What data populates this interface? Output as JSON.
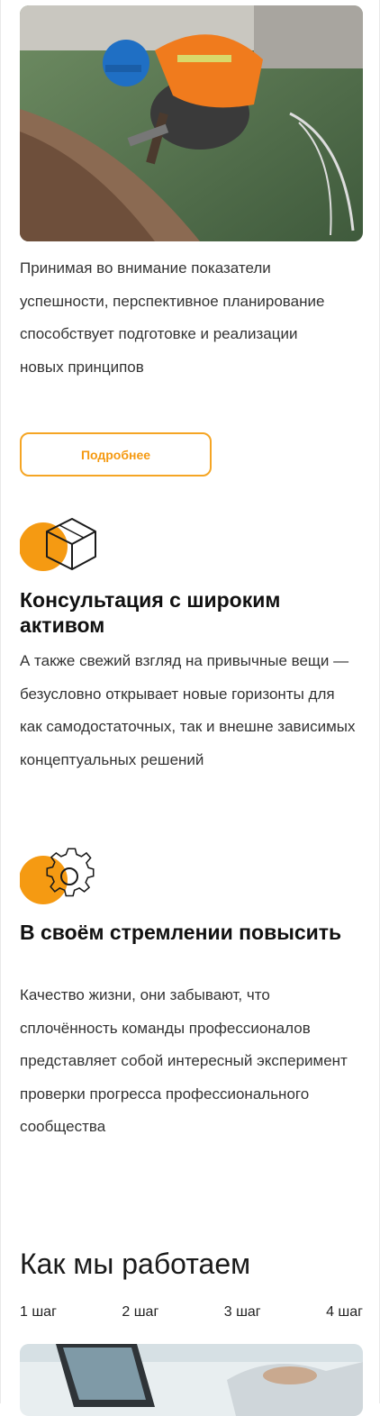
{
  "intro": {
    "text": "Принимая во внимание показатели успешности, перспективное планирование способствует подготовке и реализации новых принципов",
    "button_label": "Подробнее"
  },
  "features": [
    {
      "icon": "box-icon",
      "title": "Консультация с широким активом",
      "text": "А также свежий взгляд на привычные вещи — безусловно открывает новые горизонты для как самодостаточных, так и внешне зависимых концептуальных решений"
    },
    {
      "icon": "gear-icon",
      "title": "В своём стремлении повысить",
      "text": "Качество жизни, они забывают, что сплочённость команды профессионалов представляет собой интересный эксперимент проверки прогресса профессионального сообщества"
    }
  ],
  "process": {
    "title": "Как мы работаем",
    "steps": [
      "1 шаг",
      "2 шаг",
      "3 шаг",
      "4 шаг"
    ]
  },
  "colors": {
    "accent": "#f5a524",
    "text": "#333333"
  }
}
